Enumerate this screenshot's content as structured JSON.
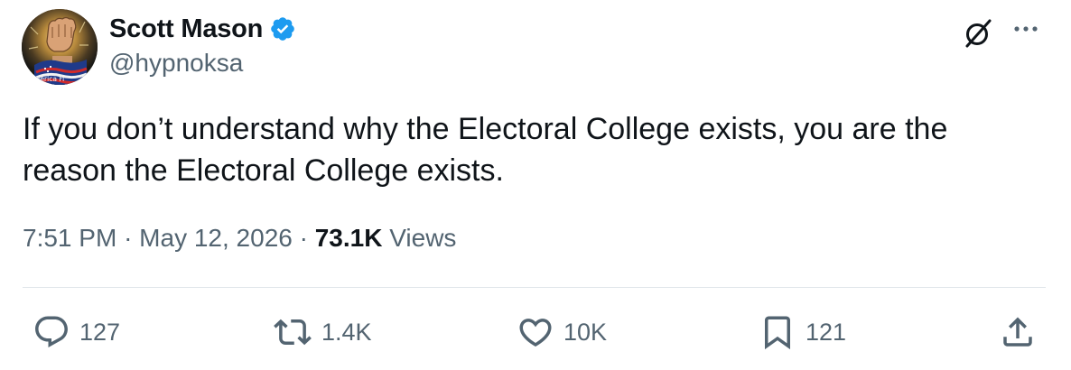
{
  "author": {
    "display_name": "Scott Mason",
    "handle": "@hypnoksa",
    "verified": true,
    "avatar_text": "America Fi"
  },
  "tweet": {
    "text": "If you don’t understand why the Electoral College exists, you are the reason the Electoral College exists.",
    "time": "7:51 PM",
    "separator": "·",
    "date": "May 12, 2026",
    "views_count": "73.1K",
    "views_label": "Views"
  },
  "actions": {
    "replies": "127",
    "reposts": "1.4K",
    "likes": "10K",
    "bookmarks": "121"
  },
  "icons": {
    "verified": "verified-badge-icon",
    "grok": "grok-icon",
    "more": "more-icon",
    "reply": "reply-icon",
    "repost": "repost-icon",
    "like": "heart-icon",
    "bookmark": "bookmark-icon",
    "share": "share-icon"
  },
  "colors": {
    "text_primary": "#0f1419",
    "text_secondary": "#536471",
    "verified_blue": "#1d9bf0",
    "divider": "#e1e6ea"
  }
}
